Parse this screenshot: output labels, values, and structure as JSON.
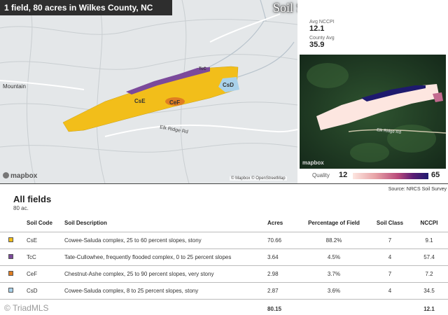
{
  "header": {
    "title": "1 field, 80 acres in Wilkes County, NC",
    "overlay_title": "Soil Survey"
  },
  "map": {
    "place_label": "Mountain",
    "road_label": "Elk Ridge Rd",
    "field_labels": [
      "CsE",
      "TcC",
      "CeF",
      "CsD"
    ],
    "logo": "mapbox",
    "attribution": "© Mapbox © OpenStreetMap"
  },
  "stats": {
    "avg_label": "Avg NCCPI",
    "avg_value": "12.1",
    "county_label": "County Avg",
    "county_value": "35.9"
  },
  "satellite": {
    "road_label": "Elk Ridge Rd",
    "logo": "mapbox"
  },
  "quality": {
    "label": "Quality",
    "min": "12",
    "max": "65"
  },
  "table": {
    "source": "Source: NRCS Soil Survey",
    "heading": "All fields",
    "acres": "80 ac.",
    "columns": [
      "Soil Code",
      "Soil Description",
      "Acres",
      "Percentage of Field",
      "Soil Class",
      "NCCPI"
    ],
    "rows": [
      {
        "color": "#f2be1a",
        "code": "CsE",
        "description": "Cowee-Saluda complex, 25 to 60 percent slopes, stony",
        "acres": "70.66",
        "pct": "88.2%",
        "class": "7",
        "nccpi": "9.1"
      },
      {
        "color": "#7b4a9b",
        "code": "TcC",
        "description": "Tate-Cullowhee, frequently flooded complex, 0 to 25 percent slopes",
        "acres": "3.64",
        "pct": "4.5%",
        "class": "4",
        "nccpi": "57.4"
      },
      {
        "color": "#e07d22",
        "code": "CeF",
        "description": "Chestnut-Ashe complex, 25 to 90 percent slopes, very stony",
        "acres": "2.98",
        "pct": "3.7%",
        "class": "7",
        "nccpi": "7.2"
      },
      {
        "color": "#a9d1ea",
        "code": "CsD",
        "description": "Cowee-Saluda complex, 8 to 25 percent slopes, stony",
        "acres": "2.87",
        "pct": "3.6%",
        "class": "4",
        "nccpi": "34.5"
      }
    ],
    "total_acres": "80.15",
    "total_nccpi": "12.1"
  },
  "watermark": "© TriadMLS"
}
